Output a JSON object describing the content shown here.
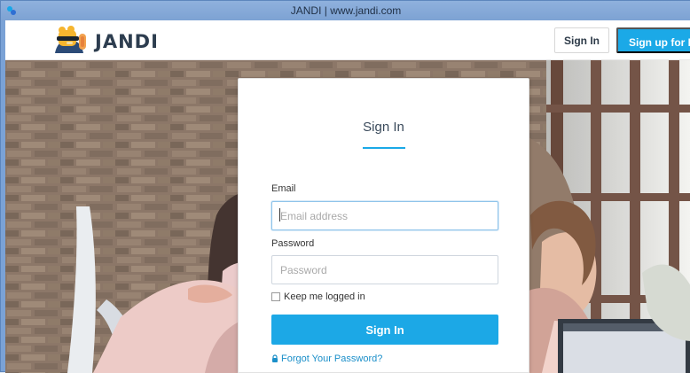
{
  "window": {
    "title": "JANDI | www.jandi.com"
  },
  "nav": {
    "logo_text": "JANDI",
    "signin_label": "Sign In",
    "signup_label": "Sign up for Free"
  },
  "login_card": {
    "title": "Sign In",
    "email_label": "Email",
    "email_placeholder": "Email address",
    "email_value": "",
    "password_label": "Password",
    "password_placeholder": "Password",
    "password_value": "",
    "remember_label": "Keep me logged in",
    "remember_checked": false,
    "submit_label": "Sign In",
    "forgot_label": "Forgot Your Password?"
  },
  "colors": {
    "brand_blue": "#1ba9e7",
    "titlebar_blue": "#7da2d3",
    "text_dark": "#2d3d4f",
    "link_blue": "#1b8fc9"
  },
  "icons": {
    "logo": "jandi-mascot-icon",
    "forgot": "lock-icon"
  }
}
